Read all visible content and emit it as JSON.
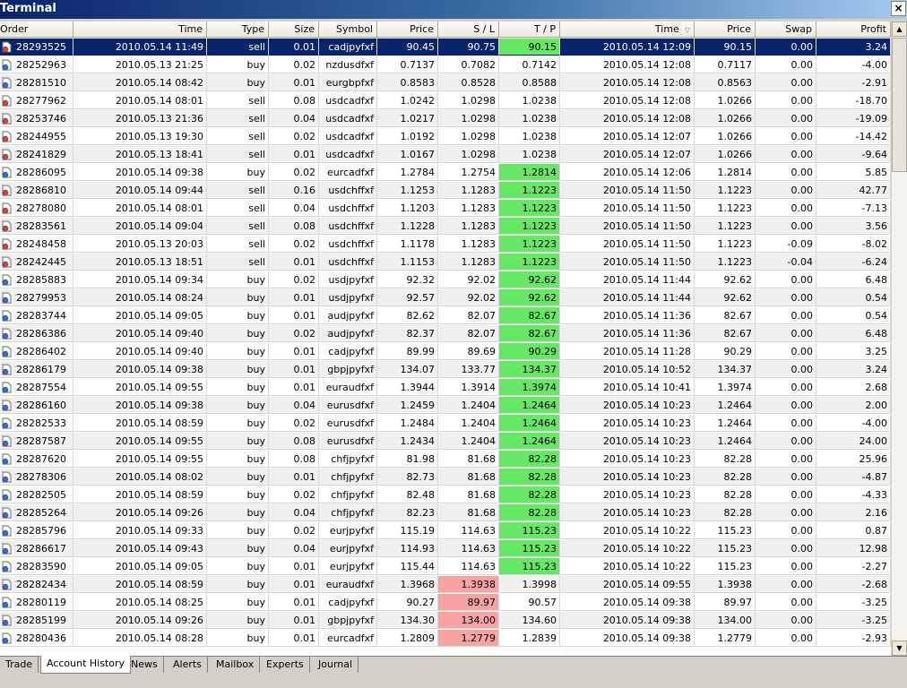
{
  "window": {
    "title": "Terminal",
    "close_label": "×"
  },
  "columns": [
    "Order",
    "Time",
    "Type",
    "Size",
    "Symbol",
    "Price",
    "S / L",
    "T / P",
    "Time",
    "Price",
    "Swap",
    "Profit"
  ],
  "sort_indicator": "▽",
  "tabs": [
    "Trade",
    "Account History",
    "News",
    "Alerts",
    "Mailbox",
    "Experts",
    "Journal"
  ],
  "active_tab": "Account History",
  "colors": {
    "selected_row": "#0a246a",
    "tp_hit": "#66e866",
    "sl_hit": "#f7a3a3"
  },
  "rows": [
    {
      "order": "28293525",
      "open_time": "2010.05.14 11:49",
      "type": "sell",
      "size": "0.01",
      "symbol": "cadjpyfxf",
      "open_price": "90.45",
      "sl": "90.75",
      "tp": "90.15",
      "close_time": "2010.05.14 12:09",
      "close_price": "90.15",
      "swap": "0.00",
      "profit": "3.24",
      "hit": "tp",
      "selected": true
    },
    {
      "order": "28252963",
      "open_time": "2010.05.13 21:25",
      "type": "buy",
      "size": "0.02",
      "symbol": "nzdusdfxf",
      "open_price": "0.7137",
      "sl": "0.7082",
      "tp": "0.7142",
      "close_time": "2010.05.14 12:08",
      "close_price": "0.7117",
      "swap": "0.00",
      "profit": "-4.00",
      "hit": ""
    },
    {
      "order": "28281510",
      "open_time": "2010.05.14 08:42",
      "type": "buy",
      "size": "0.01",
      "symbol": "eurgbpfxf",
      "open_price": "0.8583",
      "sl": "0.8528",
      "tp": "0.8588",
      "close_time": "2010.05.14 12:08",
      "close_price": "0.8563",
      "swap": "0.00",
      "profit": "-2.91",
      "hit": ""
    },
    {
      "order": "28277962",
      "open_time": "2010.05.14 08:01",
      "type": "sell",
      "size": "0.08",
      "symbol": "usdcadfxf",
      "open_price": "1.0242",
      "sl": "1.0298",
      "tp": "1.0238",
      "close_time": "2010.05.14 12:08",
      "close_price": "1.0266",
      "swap": "0.00",
      "profit": "-18.70",
      "hit": ""
    },
    {
      "order": "28253746",
      "open_time": "2010.05.13 21:36",
      "type": "sell",
      "size": "0.04",
      "symbol": "usdcadfxf",
      "open_price": "1.0217",
      "sl": "1.0298",
      "tp": "1.0238",
      "close_time": "2010.05.14 12:08",
      "close_price": "1.0266",
      "swap": "0.00",
      "profit": "-19.09",
      "hit": ""
    },
    {
      "order": "28244955",
      "open_time": "2010.05.13 19:30",
      "type": "sell",
      "size": "0.02",
      "symbol": "usdcadfxf",
      "open_price": "1.0192",
      "sl": "1.0298",
      "tp": "1.0238",
      "close_time": "2010.05.14 12:07",
      "close_price": "1.0266",
      "swap": "0.00",
      "profit": "-14.42",
      "hit": ""
    },
    {
      "order": "28241829",
      "open_time": "2010.05.13 18:41",
      "type": "sell",
      "size": "0.01",
      "symbol": "usdcadfxf",
      "open_price": "1.0167",
      "sl": "1.0298",
      "tp": "1.0238",
      "close_time": "2010.05.14 12:07",
      "close_price": "1.0266",
      "swap": "0.00",
      "profit": "-9.64",
      "hit": ""
    },
    {
      "order": "28286095",
      "open_time": "2010.05.14 09:38",
      "type": "buy",
      "size": "0.02",
      "symbol": "eurcadfxf",
      "open_price": "1.2784",
      "sl": "1.2754",
      "tp": "1.2814",
      "close_time": "2010.05.14 12:06",
      "close_price": "1.2814",
      "swap": "0.00",
      "profit": "5.85",
      "hit": "tp"
    },
    {
      "order": "28286810",
      "open_time": "2010.05.14 09:44",
      "type": "sell",
      "size": "0.16",
      "symbol": "usdchffxf",
      "open_price": "1.1253",
      "sl": "1.1283",
      "tp": "1.1223",
      "close_time": "2010.05.14 11:50",
      "close_price": "1.1223",
      "swap": "0.00",
      "profit": "42.77",
      "hit": "tp"
    },
    {
      "order": "28278080",
      "open_time": "2010.05.14 08:01",
      "type": "sell",
      "size": "0.04",
      "symbol": "usdchffxf",
      "open_price": "1.1203",
      "sl": "1.1283",
      "tp": "1.1223",
      "close_time": "2010.05.14 11:50",
      "close_price": "1.1223",
      "swap": "0.00",
      "profit": "-7.13",
      "hit": "tp"
    },
    {
      "order": "28283561",
      "open_time": "2010.05.14 09:04",
      "type": "sell",
      "size": "0.08",
      "symbol": "usdchffxf",
      "open_price": "1.1228",
      "sl": "1.1283",
      "tp": "1.1223",
      "close_time": "2010.05.14 11:50",
      "close_price": "1.1223",
      "swap": "0.00",
      "profit": "3.56",
      "hit": "tp"
    },
    {
      "order": "28248458",
      "open_time": "2010.05.13 20:03",
      "type": "sell",
      "size": "0.02",
      "symbol": "usdchffxf",
      "open_price": "1.1178",
      "sl": "1.1283",
      "tp": "1.1223",
      "close_time": "2010.05.14 11:50",
      "close_price": "1.1223",
      "swap": "-0.09",
      "profit": "-8.02",
      "hit": "tp"
    },
    {
      "order": "28242445",
      "open_time": "2010.05.13 18:51",
      "type": "sell",
      "size": "0.01",
      "symbol": "usdchffxf",
      "open_price": "1.1153",
      "sl": "1.1283",
      "tp": "1.1223",
      "close_time": "2010.05.14 11:50",
      "close_price": "1.1223",
      "swap": "-0.04",
      "profit": "-6.24",
      "hit": "tp"
    },
    {
      "order": "28285883",
      "open_time": "2010.05.14 09:34",
      "type": "buy",
      "size": "0.02",
      "symbol": "usdjpyfxf",
      "open_price": "92.32",
      "sl": "92.02",
      "tp": "92.62",
      "close_time": "2010.05.14 11:44",
      "close_price": "92.62",
      "swap": "0.00",
      "profit": "6.48",
      "hit": "tp"
    },
    {
      "order": "28279953",
      "open_time": "2010.05.14 08:24",
      "type": "buy",
      "size": "0.01",
      "symbol": "usdjpyfxf",
      "open_price": "92.57",
      "sl": "92.02",
      "tp": "92.62",
      "close_time": "2010.05.14 11:44",
      "close_price": "92.62",
      "swap": "0.00",
      "profit": "0.54",
      "hit": "tp"
    },
    {
      "order": "28283744",
      "open_time": "2010.05.14 09:05",
      "type": "buy",
      "size": "0.01",
      "symbol": "audjpyfxf",
      "open_price": "82.62",
      "sl": "82.07",
      "tp": "82.67",
      "close_time": "2010.05.14 11:36",
      "close_price": "82.67",
      "swap": "0.00",
      "profit": "0.54",
      "hit": "tp"
    },
    {
      "order": "28286386",
      "open_time": "2010.05.14 09:40",
      "type": "buy",
      "size": "0.02",
      "symbol": "audjpyfxf",
      "open_price": "82.37",
      "sl": "82.07",
      "tp": "82.67",
      "close_time": "2010.05.14 11:36",
      "close_price": "82.67",
      "swap": "0.00",
      "profit": "6.48",
      "hit": "tp"
    },
    {
      "order": "28286402",
      "open_time": "2010.05.14 09:40",
      "type": "buy",
      "size": "0.01",
      "symbol": "cadjpyfxf",
      "open_price": "89.99",
      "sl": "89.69",
      "tp": "90.29",
      "close_time": "2010.05.14 11:28",
      "close_price": "90.29",
      "swap": "0.00",
      "profit": "3.25",
      "hit": "tp"
    },
    {
      "order": "28286179",
      "open_time": "2010.05.14 09:38",
      "type": "buy",
      "size": "0.01",
      "symbol": "gbpjpyfxf",
      "open_price": "134.07",
      "sl": "133.77",
      "tp": "134.37",
      "close_time": "2010.05.14 10:52",
      "close_price": "134.37",
      "swap": "0.00",
      "profit": "3.24",
      "hit": "tp"
    },
    {
      "order": "28287554",
      "open_time": "2010.05.14 09:55",
      "type": "buy",
      "size": "0.01",
      "symbol": "euraudfxf",
      "open_price": "1.3944",
      "sl": "1.3914",
      "tp": "1.3974",
      "close_time": "2010.05.14 10:41",
      "close_price": "1.3974",
      "swap": "0.00",
      "profit": "2.68",
      "hit": "tp"
    },
    {
      "order": "28286160",
      "open_time": "2010.05.14 09:38",
      "type": "buy",
      "size": "0.04",
      "symbol": "eurusdfxf",
      "open_price": "1.2459",
      "sl": "1.2404",
      "tp": "1.2464",
      "close_time": "2010.05.14 10:23",
      "close_price": "1.2464",
      "swap": "0.00",
      "profit": "2.00",
      "hit": "tp"
    },
    {
      "order": "28282533",
      "open_time": "2010.05.14 08:59",
      "type": "buy",
      "size": "0.02",
      "symbol": "eurusdfxf",
      "open_price": "1.2484",
      "sl": "1.2404",
      "tp": "1.2464",
      "close_time": "2010.05.14 10:23",
      "close_price": "1.2464",
      "swap": "0.00",
      "profit": "-4.00",
      "hit": "tp"
    },
    {
      "order": "28287587",
      "open_time": "2010.05.14 09:55",
      "type": "buy",
      "size": "0.08",
      "symbol": "eurusdfxf",
      "open_price": "1.2434",
      "sl": "1.2404",
      "tp": "1.2464",
      "close_time": "2010.05.14 10:23",
      "close_price": "1.2464",
      "swap": "0.00",
      "profit": "24.00",
      "hit": "tp"
    },
    {
      "order": "28287620",
      "open_time": "2010.05.14 09:55",
      "type": "buy",
      "size": "0.08",
      "symbol": "chfjpyfxf",
      "open_price": "81.98",
      "sl": "81.68",
      "tp": "82.28",
      "close_time": "2010.05.14 10:23",
      "close_price": "82.28",
      "swap": "0.00",
      "profit": "25.96",
      "hit": "tp"
    },
    {
      "order": "28278306",
      "open_time": "2010.05.14 08:02",
      "type": "buy",
      "size": "0.01",
      "symbol": "chfjpyfxf",
      "open_price": "82.73",
      "sl": "81.68",
      "tp": "82.28",
      "close_time": "2010.05.14 10:23",
      "close_price": "82.28",
      "swap": "0.00",
      "profit": "-4.87",
      "hit": "tp"
    },
    {
      "order": "28282505",
      "open_time": "2010.05.14 08:59",
      "type": "buy",
      "size": "0.02",
      "symbol": "chfjpyfxf",
      "open_price": "82.48",
      "sl": "81.68",
      "tp": "82.28",
      "close_time": "2010.05.14 10:23",
      "close_price": "82.28",
      "swap": "0.00",
      "profit": "-4.33",
      "hit": "tp"
    },
    {
      "order": "28285264",
      "open_time": "2010.05.14 09:26",
      "type": "buy",
      "size": "0.04",
      "symbol": "chfjpyfxf",
      "open_price": "82.23",
      "sl": "81.68",
      "tp": "82.28",
      "close_time": "2010.05.14 10:23",
      "close_price": "82.28",
      "swap": "0.00",
      "profit": "2.16",
      "hit": "tp"
    },
    {
      "order": "28285796",
      "open_time": "2010.05.14 09:33",
      "type": "buy",
      "size": "0.02",
      "symbol": "eurjpyfxf",
      "open_price": "115.19",
      "sl": "114.63",
      "tp": "115.23",
      "close_time": "2010.05.14 10:22",
      "close_price": "115.23",
      "swap": "0.00",
      "profit": "0.87",
      "hit": "tp"
    },
    {
      "order": "28286617",
      "open_time": "2010.05.14 09:43",
      "type": "buy",
      "size": "0.04",
      "symbol": "eurjpyfxf",
      "open_price": "114.93",
      "sl": "114.63",
      "tp": "115.23",
      "close_time": "2010.05.14 10:22",
      "close_price": "115.23",
      "swap": "0.00",
      "profit": "12.98",
      "hit": "tp"
    },
    {
      "order": "28283590",
      "open_time": "2010.05.14 09:05",
      "type": "buy",
      "size": "0.01",
      "symbol": "eurjpyfxf",
      "open_price": "115.44",
      "sl": "114.63",
      "tp": "115.23",
      "close_time": "2010.05.14 10:22",
      "close_price": "115.23",
      "swap": "0.00",
      "profit": "-2.27",
      "hit": "tp"
    },
    {
      "order": "28282434",
      "open_time": "2010.05.14 08:59",
      "type": "buy",
      "size": "0.01",
      "symbol": "euraudfxf",
      "open_price": "1.3968",
      "sl": "1.3938",
      "tp": "1.3998",
      "close_time": "2010.05.14 09:55",
      "close_price": "1.3938",
      "swap": "0.00",
      "profit": "-2.68",
      "hit": "sl"
    },
    {
      "order": "28280119",
      "open_time": "2010.05.14 08:25",
      "type": "buy",
      "size": "0.01",
      "symbol": "cadjpyfxf",
      "open_price": "90.27",
      "sl": "89.97",
      "tp": "90.57",
      "close_time": "2010.05.14 09:38",
      "close_price": "89.97",
      "swap": "0.00",
      "profit": "-3.25",
      "hit": "sl"
    },
    {
      "order": "28285199",
      "open_time": "2010.05.14 09:26",
      "type": "buy",
      "size": "0.01",
      "symbol": "gbpjpyfxf",
      "open_price": "134.30",
      "sl": "134.00",
      "tp": "134.60",
      "close_time": "2010.05.14 09:38",
      "close_price": "134.00",
      "swap": "0.00",
      "profit": "-3.25",
      "hit": "sl"
    },
    {
      "order": "28280436",
      "open_time": "2010.05.14 08:28",
      "type": "buy",
      "size": "0.01",
      "symbol": "eurcadfxf",
      "open_price": "1.2809",
      "sl": "1.2779",
      "tp": "1.2839",
      "close_time": "2010.05.14 09:38",
      "close_price": "1.2779",
      "swap": "0.00",
      "profit": "-2.93",
      "hit": "sl"
    }
  ]
}
